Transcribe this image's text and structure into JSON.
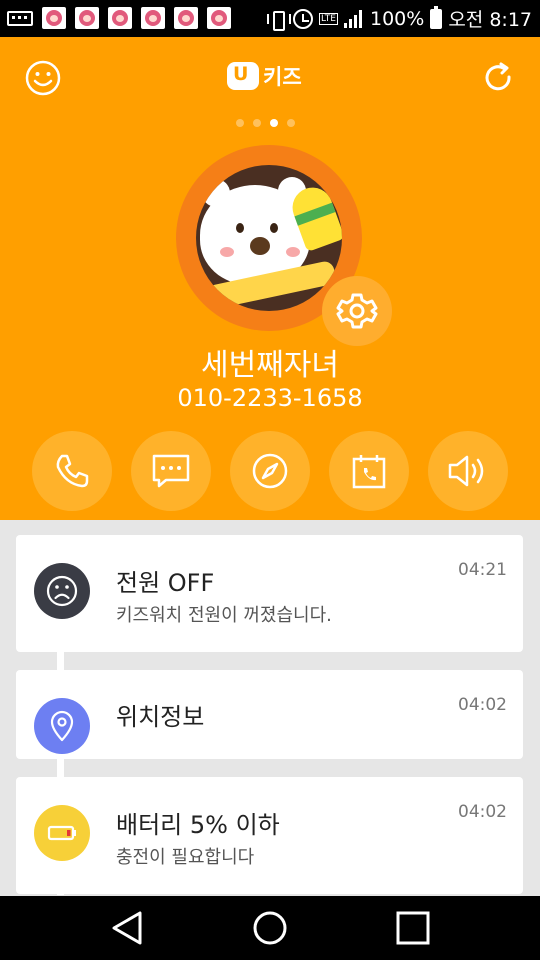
{
  "status_bar": {
    "battery_percent": "100%",
    "time": "오전 8:17",
    "network": "LTE",
    "notification_count": 6
  },
  "header": {
    "logo_text": "키즈",
    "page_index": 3,
    "page_count": 4,
    "colors": {
      "background": "#ff9f00",
      "ring": "#f57f17"
    }
  },
  "profile": {
    "name": "세번째자녀",
    "phone": "010-2233-1658"
  },
  "actions": [
    {
      "icon": "phone-icon"
    },
    {
      "icon": "message-icon"
    },
    {
      "icon": "compass-icon"
    },
    {
      "icon": "calendar-phone-icon"
    },
    {
      "icon": "volume-icon"
    }
  ],
  "feed": [
    {
      "title": "전원 OFF",
      "subtitle": "키즈워치 전원이 꺼졌습니다.",
      "time": "04:21",
      "icon": "sad-face-icon",
      "color": "#3a3c45"
    },
    {
      "title": "위치정보",
      "subtitle": "",
      "time": "04:02",
      "icon": "location-pin-icon",
      "color": "#6d7ff2"
    },
    {
      "title": "배터리 5% 이하",
      "subtitle": "충전이 필요합니다",
      "time": "04:02",
      "icon": "low-battery-icon",
      "color": "#f7d038"
    }
  ]
}
